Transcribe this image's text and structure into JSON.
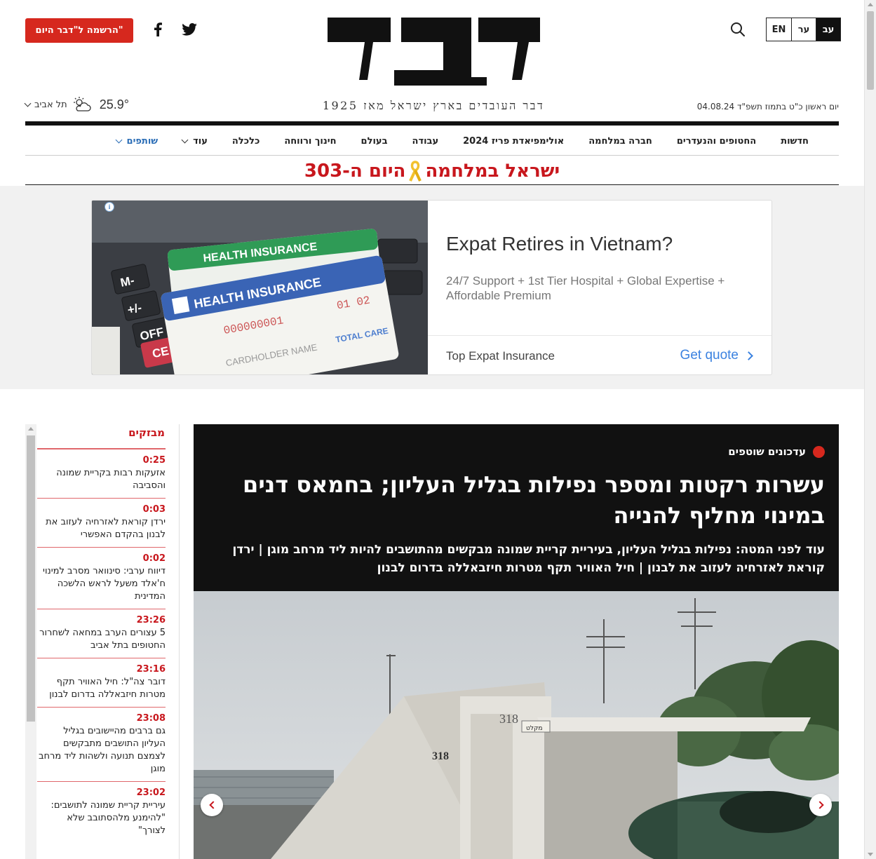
{
  "header": {
    "subscribe_label": "הרשמה ל\"דבר היום\"",
    "tagline": "דבר העובדים בארץ ישראל מאז 1925",
    "date": "יום ראשון כ\"ט בתמוז תשפ\"ד 04.08.24",
    "languages": [
      "עב",
      "ער",
      "EN"
    ],
    "weather": {
      "temp": "25.9°",
      "city": "תל אביב"
    }
  },
  "nav": {
    "items": [
      "חדשות",
      "החטופים והנעדרים",
      "חברה במלחמה",
      "אולימפיאדת פריז 2024",
      "עבודה",
      "בעולם",
      "חינוך ורווחה",
      "כלכלה",
      "עוד",
      "שותפים"
    ]
  },
  "war_banner": {
    "left": "ישראל במלחמה",
    "right": "היום ה-303"
  },
  "ad": {
    "title": "Expat Retires in Vietnam?",
    "description": "24/7 Support + 1st Tier Hospital + Global Expertise + Affordable Premium",
    "advertiser": "Top Expat Insurance",
    "cta": "Get quote",
    "card_text_1": "HEALTH INSURANCE",
    "card_text_2": "HEALTH INSURANCE",
    "card_number": "000000001",
    "card_date": "01 02",
    "card_name": "CARDHOLDER NAME",
    "card_total": "TOTAL CARE",
    "calc_keys": [
      "M-",
      "+/-",
      "OFF",
      "CE"
    ]
  },
  "ticker": {
    "title": "מבזקים",
    "items": [
      {
        "time": "0:25",
        "text": "אזעקות רבות בקריית שמונה והסביבה"
      },
      {
        "time": "0:03",
        "text": "ירדן קוראת לאזרחיה לעזוב את לבנון בהקדם האפשרי"
      },
      {
        "time": "0:02",
        "text": "דיווח ערבי: סינוואר מסרב למינוי ח'אלד משעל לראש הלשכה המדינית"
      },
      {
        "time": "23:26",
        "text": "5 עצורים הערב במחאה לשחרור החטופים בתל אביב"
      },
      {
        "time": "23:16",
        "text": "דובר צה\"ל: חיל האוויר תקף מטרות חיזבאללה בדרום לבנון"
      },
      {
        "time": "23:08",
        "text": "גם ברבים מהיישובים בגליל העליון התושבים מתבקשים לצמצם תנועה ולשהות ליד מרחב מוגן"
      },
      {
        "time": "23:02",
        "text": "עיריית קריית שמונה לתושבים: \"להימנע מלהסתובב שלא לצורך\""
      }
    ]
  },
  "hero": {
    "kicker": "עדכונים שוטפים",
    "title": "עשרות רקטות ומספר נפילות בגליל העליון; בחמאס דנים במינוי מחליף להנייה",
    "subtitle": "עוד לפני המטה: נפילות בגליל העליון, בעיריית קריית שמונה מבקשים מהתושבים להיות ליד מרחב מוגן | ירדן קוראת לאזרחיה לעזוב את לבנון | חיל האוויר תקף מטרות חיזבאללה בדרום לבנון",
    "photo_labels": {
      "door_number": "318",
      "door_sign": "318",
      "wall_number": "318",
      "wall_sign": "מקלט"
    }
  },
  "colors": {
    "brand_red": "#d6281e",
    "link_blue": "#2a6db6",
    "ad_blue": "#3b82e0"
  }
}
